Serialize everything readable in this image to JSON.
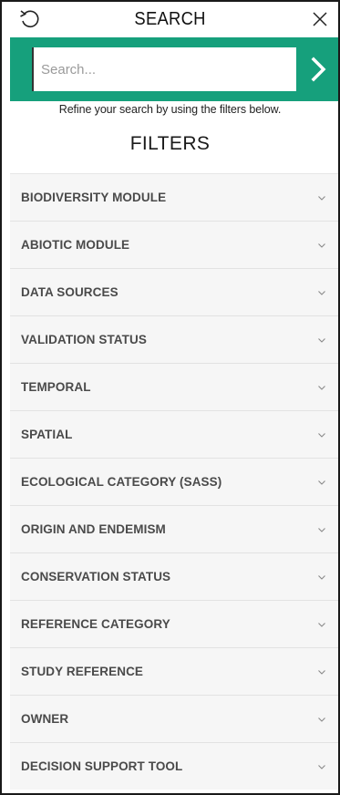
{
  "header": {
    "title": "SEARCH",
    "reset_icon": "undo-icon",
    "close_icon": "close-icon"
  },
  "search": {
    "placeholder": "Search...",
    "value": "",
    "submit_icon": "chevron-right-icon"
  },
  "hint": "Refine your search by using the filters below.",
  "filters_title": "FILTERS",
  "filters": [
    {
      "label": "BIODIVERSITY MODULE",
      "icon": "chevron-down-icon"
    },
    {
      "label": "ABIOTIC MODULE",
      "icon": "chevron-down-icon"
    },
    {
      "label": "DATA SOURCES",
      "icon": "chevron-down-icon"
    },
    {
      "label": "VALIDATION STATUS",
      "icon": "chevron-down-icon"
    },
    {
      "label": "TEMPORAL",
      "icon": "chevron-down-icon"
    },
    {
      "label": "SPATIAL",
      "icon": "chevron-down-icon"
    },
    {
      "label": "ECOLOGICAL CATEGORY (SASS)",
      "icon": "chevron-down-icon"
    },
    {
      "label": "ORIGIN AND ENDEMISM",
      "icon": "chevron-down-icon"
    },
    {
      "label": "CONSERVATION STATUS",
      "icon": "chevron-down-icon"
    },
    {
      "label": "REFERENCE CATEGORY",
      "icon": "chevron-down-icon"
    },
    {
      "label": "STUDY REFERENCE",
      "icon": "chevron-down-icon"
    },
    {
      "label": "OWNER",
      "icon": "chevron-down-icon"
    },
    {
      "label": "DECISION SUPPORT TOOL",
      "icon": "chevron-down-icon"
    }
  ],
  "colors": {
    "accent": "#16a07c",
    "row_background": "#f6f6f6",
    "label_text": "#4a4a4a"
  }
}
